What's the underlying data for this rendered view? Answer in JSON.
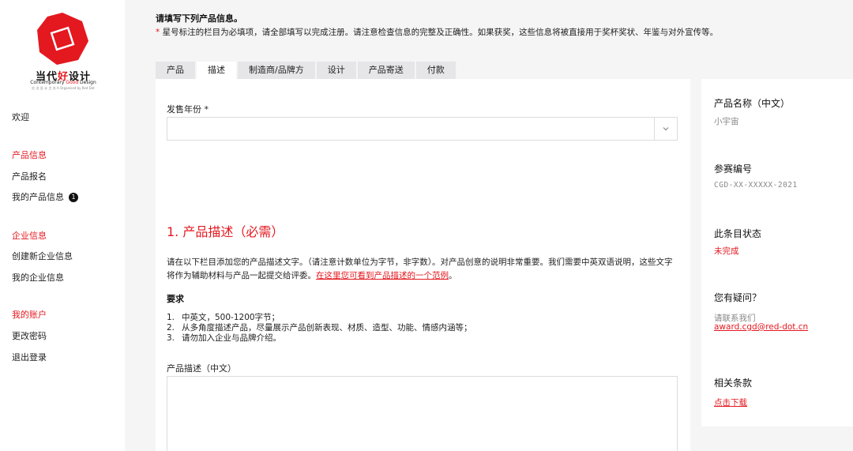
{
  "sidebar": {
    "logo": {
      "brand_cn_pre": "当代",
      "brand_cn_hl": "好",
      "brand_cn_post": "设计",
      "brand_en_pre": "Contemporary ",
      "brand_en_hl": "Good",
      "brand_en_post": " Design",
      "subtitle": "红 点 设 计 主 办 A Organised by Red Dot",
      "accent_color": "#e4181f"
    },
    "welcome": "欢迎",
    "product_section": "产品信息",
    "product_register": "产品报名",
    "my_products": "我的产品信息",
    "my_products_badge": "1",
    "company_section": "企业信息",
    "create_company": "创建新企业信息",
    "my_company": "我的企业信息",
    "account_section": "我的账户",
    "change_password": "更改密码",
    "logout": "退出登录"
  },
  "notice": {
    "title": "请填写下列产品信息。",
    "star": "*",
    "text": " 星号标注的栏目为必填项，请全部填写以完成注册。请注意检查信息的完整及正确性。如果获奖，这些信息将被直接用于奖杯奖状、年鉴与对外宣传等。"
  },
  "tabs": {
    "product": "产品",
    "description": "描述",
    "manufacturer": "制造商/品牌方",
    "design": "设计",
    "shipping": "产品寄送",
    "payment": "付款",
    "active": "描述"
  },
  "form": {
    "sale_year_label": "发售年份 *",
    "sale_year_value": "",
    "section_title": "1. 产品描述（必需）",
    "desc_text": "请在以下栏目添加您的产品描述文字。（请注意计数单位为字节，非字数）。对产品创意的说明非常重要。我们需要中英双语说明，这些文字将作为辅助材料与产品一起提交给评委。",
    "desc_link": "在这里您可看到产品描述的一个范例",
    "desc_end": "。",
    "req_title": "要求",
    "requirements": [
      {
        "num": "1.",
        "text": "中英文，500-1200字节；"
      },
      {
        "num": "2.",
        "text": "从多角度描述产品，尽量展示产品创新表现、材质、造型、功能、情感内涵等；"
      },
      {
        "num": "3.",
        "text": "请勿加入企业与品牌介绍。"
      }
    ],
    "cn_desc_label": "产品描述（中文）",
    "cn_desc_value": ""
  },
  "info": {
    "name_label": "产品名称（中文）",
    "name_value": "小宇宙",
    "entry_label": "参赛编号",
    "entry_value": "CGD-XX-XXXXX-2021",
    "status_label": "此条目状态",
    "status_value": "未完成",
    "help_label": "您有疑问？",
    "help_contact": "请联系我们",
    "help_email": "award.cgd@red-dot.cn",
    "terms_label": "相关条款",
    "terms_link": "点击下载"
  }
}
